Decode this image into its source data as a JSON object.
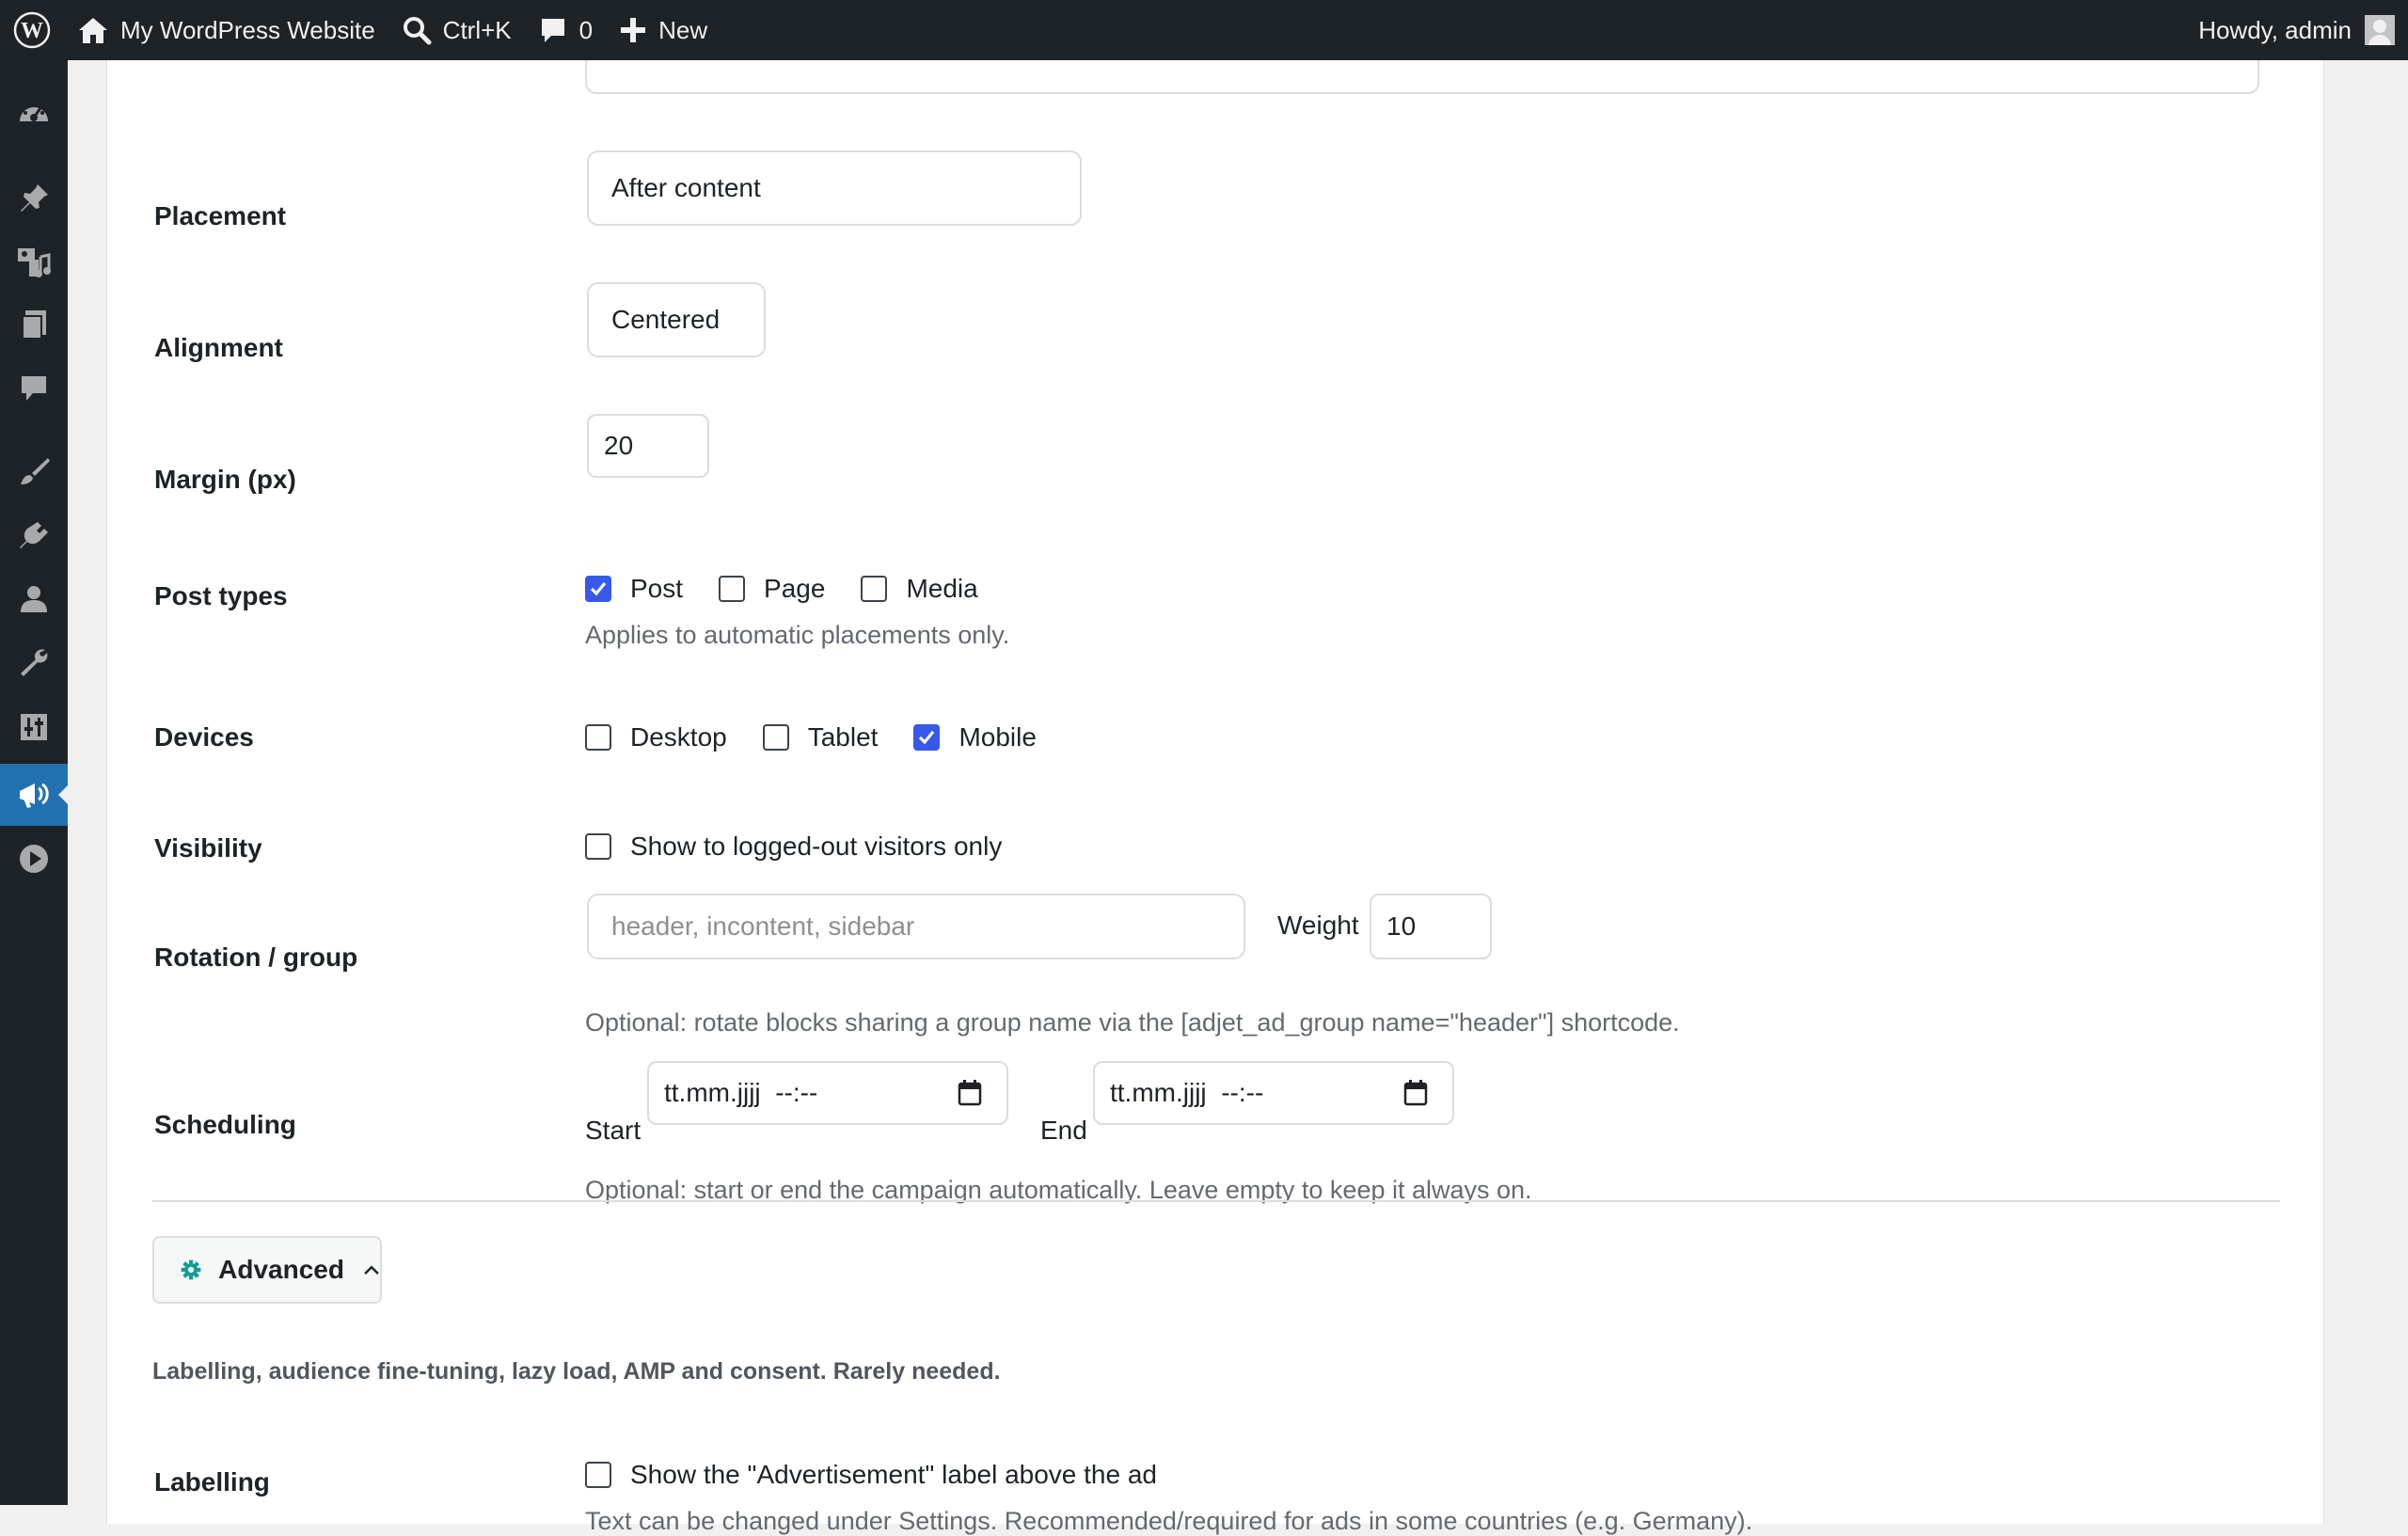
{
  "adminbar": {
    "site_name": "My WordPress Website",
    "search_shortcut": "Ctrl+K",
    "comments_count": "0",
    "new_label": "New",
    "greeting": "Howdy, admin"
  },
  "form": {
    "placement": {
      "label": "Placement",
      "value": "After content"
    },
    "alignment": {
      "label": "Alignment",
      "value": "Centered"
    },
    "margin": {
      "label": "Margin (px)",
      "value": "20"
    },
    "post_types": {
      "label": "Post types",
      "options": [
        {
          "label": "Post",
          "checked": true
        },
        {
          "label": "Page",
          "checked": false
        },
        {
          "label": "Media",
          "checked": false
        }
      ],
      "description": "Applies to automatic placements only."
    },
    "devices": {
      "label": "Devices",
      "options": [
        {
          "label": "Desktop",
          "checked": false
        },
        {
          "label": "Tablet",
          "checked": false
        },
        {
          "label": "Mobile",
          "checked": true
        }
      ]
    },
    "visibility": {
      "label": "Visibility",
      "option_label": "Show to logged-out visitors only",
      "checked": false
    },
    "rotation": {
      "label": "Rotation / group",
      "placeholder": "header, incontent, sidebar",
      "weight_label": "Weight",
      "weight_value": "10",
      "description": "Optional: rotate blocks sharing a group name via the [adjet_ad_group name=\"header\"] shortcode."
    },
    "scheduling": {
      "label": "Scheduling",
      "start_label": "Start",
      "start_value": "tt.mm.jjjj  --:--",
      "end_label": "End",
      "end_value": "tt.mm.jjjj  --:--",
      "description": "Optional: start or end the campaign automatically. Leave empty to keep it always on."
    },
    "advanced": {
      "button_label": "Advanced",
      "description": "Labelling, audience fine-tuning, lazy load, AMP and consent. Rarely needed."
    },
    "labelling": {
      "label": "Labelling",
      "option_label": "Show the \"Advertisement\" label above the ad",
      "checked": false,
      "description": "Text can be changed under Settings. Recommended/required for ads in some countries (e.g. Germany)."
    }
  },
  "colors": {
    "adminbar_bg": "#1d2327",
    "active_menu": "#2271b1",
    "checkbox_checked": "#3858e9",
    "advanced_gear": "#0e9f8f"
  }
}
